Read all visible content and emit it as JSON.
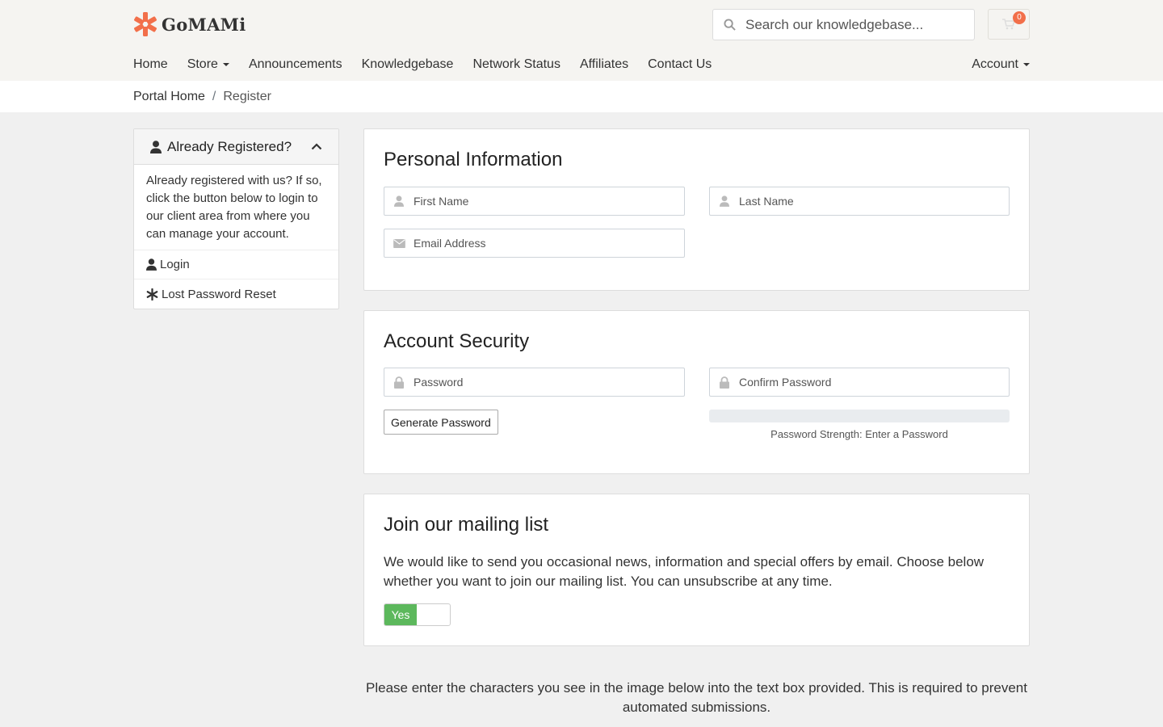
{
  "brand": {
    "name": "GoMAMi",
    "accent": "#f26f4a"
  },
  "search": {
    "placeholder": "Search our knowledgebase..."
  },
  "cart": {
    "count": "0"
  },
  "nav": {
    "items": [
      {
        "label": "Home"
      },
      {
        "label": "Store"
      },
      {
        "label": "Announcements"
      },
      {
        "label": "Knowledgebase"
      },
      {
        "label": "Network Status"
      },
      {
        "label": "Affiliates"
      },
      {
        "label": "Contact Us"
      }
    ],
    "account": "Account"
  },
  "breadcrumb": {
    "home": "Portal Home",
    "sep": "/",
    "current": "Register"
  },
  "sidebar": {
    "title": "Already Registered?",
    "body": "Already registered with us? If so, click the button below to login to our client area from where you can manage your account.",
    "login": "Login",
    "reset": "Lost Password Reset"
  },
  "personal": {
    "title": "Personal Information",
    "first_name": "First Name",
    "last_name": "Last Name",
    "email": "Email Address"
  },
  "security": {
    "title": "Account Security",
    "password": "Password",
    "confirm": "Confirm Password",
    "generate": "Generate Password",
    "strength": "Password Strength: Enter a Password"
  },
  "mailing": {
    "title": "Join our mailing list",
    "text": "We would like to send you occasional news, information and special offers by email. Choose below whether you want to join our mailing list. You can unsubscribe at any time.",
    "toggle_on": "Yes",
    "toggle_color": "#5cb85c"
  },
  "captcha": {
    "text": "Please enter the characters you see in the image below into the text box provided. This is required to prevent automated submissions."
  }
}
